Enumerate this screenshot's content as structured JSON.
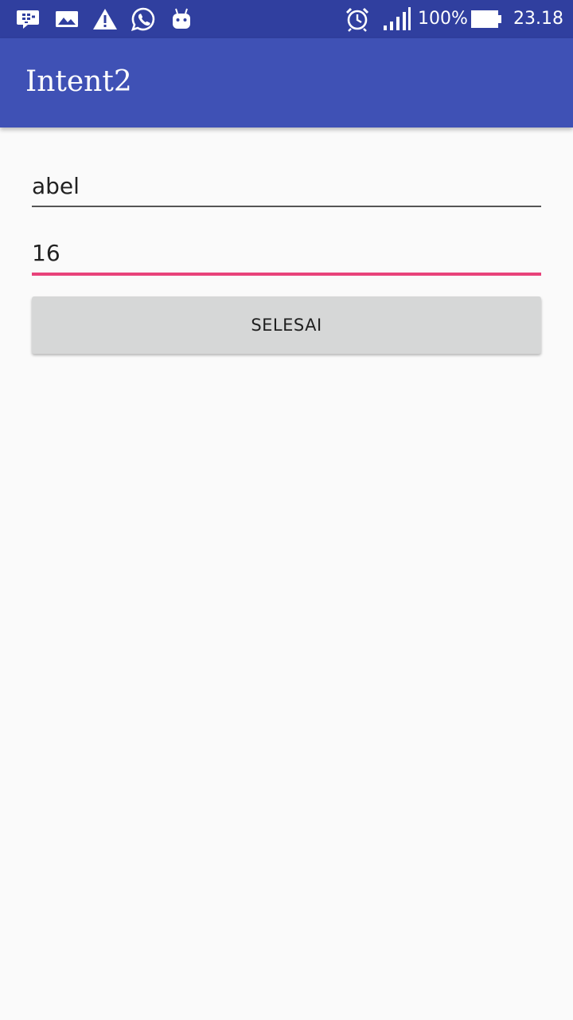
{
  "status_bar": {
    "icons": [
      "bbm-icon",
      "image-icon",
      "warning-icon",
      "whatsapp-icon",
      "android-icon",
      "alarm-icon",
      "signal-icon",
      "battery-icon"
    ],
    "battery": "100%",
    "time": "23.18"
  },
  "toolbar": {
    "title": "Intent2"
  },
  "form": {
    "name_value": "abel",
    "age_value": "16",
    "submit_label": "SELESAI"
  },
  "colors": {
    "status_bar": "#303f9f",
    "toolbar": "#3f51b5",
    "accent": "#e8437a",
    "background": "#fafafa",
    "button": "#d6d7d7"
  }
}
